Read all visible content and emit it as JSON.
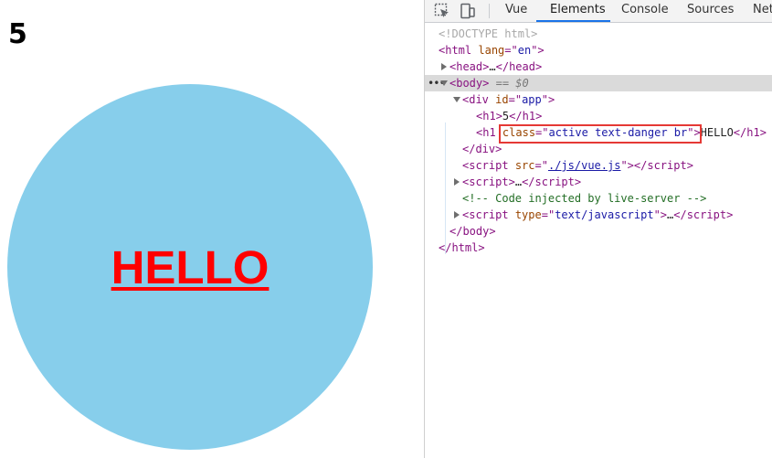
{
  "page": {
    "h1_number": "5",
    "h1_text": "HELLO"
  },
  "colors": {
    "circle": "#87ceeb",
    "hello_text": "#ff0000",
    "highlight_box": "#e53935"
  },
  "devtools": {
    "icons": [
      "inspect-element-icon",
      "device-toolbar-icon"
    ],
    "tabs": [
      "Vue",
      "Elements",
      "Console",
      "Sources",
      "Net"
    ],
    "active_tab": "Elements",
    "dom": {
      "doctype": "<!DOCTYPE html>",
      "html_open": "<html lang=\"en\">",
      "html_tag": "html",
      "lang_attr": "lang",
      "lang_val": "en",
      "head": "head",
      "head_ellipsis": "…",
      "body": "body",
      "body_ref": "== $0",
      "div": "div",
      "div_attr": "id",
      "div_val": "app",
      "h1": "h1",
      "h1_text": "5",
      "h1_2_attr": "class",
      "h1_2_val": "active text-danger br",
      "h1_2_text": "HELLO",
      "script": "script",
      "script_src_attr": "src",
      "script_src_val": "./js/vue.js",
      "script_ellipsis": "…",
      "comment": "<!-- Code injected by live-server -->",
      "script_type_attr": "type",
      "script_type_val": "text/javascript"
    }
  }
}
